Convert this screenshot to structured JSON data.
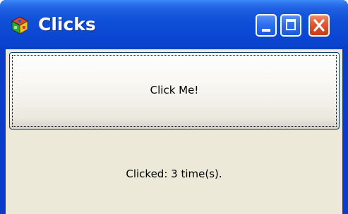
{
  "window": {
    "title": "Clicks",
    "icon": "app-cube-icon",
    "controls": {
      "minimize": "minimize-icon",
      "maximize": "maximize-icon",
      "close": "close-icon"
    }
  },
  "main": {
    "button_label": "Click Me!",
    "status_text": "Clicked: 3 time(s)."
  },
  "colors": {
    "titlebar": "#0a44cf",
    "client_background": "#ece9d8",
    "close_button": "#e2552f"
  }
}
